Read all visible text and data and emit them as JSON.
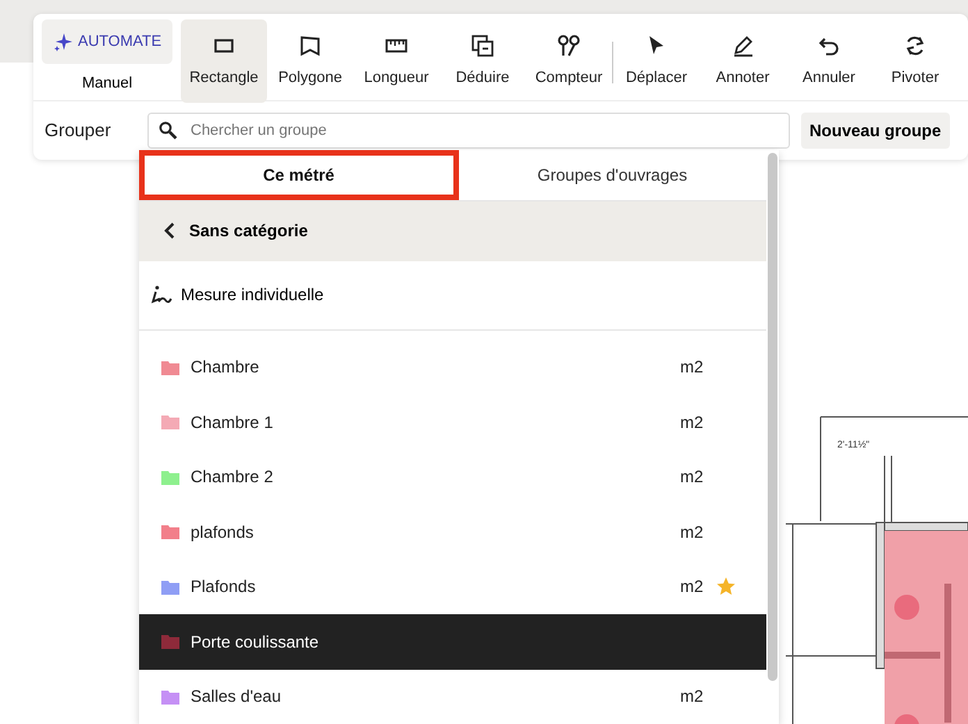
{
  "mode_switch": {
    "automate": "AUTOMATE",
    "manual": "Manuel"
  },
  "tool_groups": [
    [
      {
        "kind": "rectangle",
        "label": "Rectangle",
        "selected": true
      },
      {
        "kind": "polygon",
        "label": "Polygone",
        "selected": false
      },
      {
        "kind": "ruler",
        "label": "Longueur",
        "selected": false
      },
      {
        "kind": "deduct",
        "label": "Déduire",
        "selected": false
      },
      {
        "kind": "counter",
        "label": "Compteur",
        "selected": false
      }
    ],
    [
      {
        "kind": "pointer",
        "label": "Déplacer",
        "selected": false
      },
      {
        "kind": "pen",
        "label": "Annoter",
        "selected": false
      },
      {
        "kind": "undo",
        "label": "Annuler",
        "selected": false
      },
      {
        "kind": "rotate",
        "label": "Pivoter",
        "selected": false
      }
    ]
  ],
  "group_bar": {
    "label": "Grouper",
    "search": {
      "placeholder": "Chercher un groupe"
    },
    "new_button": "Nouveau groupe"
  },
  "dropdown": {
    "tabs": [
      {
        "label": "Ce métré",
        "selected": true,
        "highlighted": true
      },
      {
        "label": "Groupes d'ouvrages",
        "selected": false,
        "highlighted": false
      }
    ],
    "back": "Sans catégorie",
    "individual": "Mesure individuelle",
    "groups": [
      {
        "name": "Chambre",
        "unit": "m2",
        "color": "#f08a93",
        "favorite": false,
        "selected": false
      },
      {
        "name": "Chambre 1",
        "unit": "m2",
        "color": "#f4aab5",
        "favorite": false,
        "selected": false
      },
      {
        "name": "Chambre 2",
        "unit": "m2",
        "color": "#8ef08e",
        "favorite": false,
        "selected": false
      },
      {
        "name": "plafonds",
        "unit": "m2",
        "color": "#f27f8a",
        "favorite": false,
        "selected": false
      },
      {
        "name": "Plafonds",
        "unit": "m2",
        "color": "#8f9ef5",
        "favorite": true,
        "selected": false
      },
      {
        "name": "Porte coulissante",
        "color": "#8e2a3a",
        "favorite": false,
        "selected": true
      },
      {
        "name": "Salles d'eau",
        "unit": "m2",
        "color": "#c590f5",
        "favorite": false,
        "selected": false
      }
    ]
  },
  "plan": {
    "dimension": "2'-11½\""
  }
}
